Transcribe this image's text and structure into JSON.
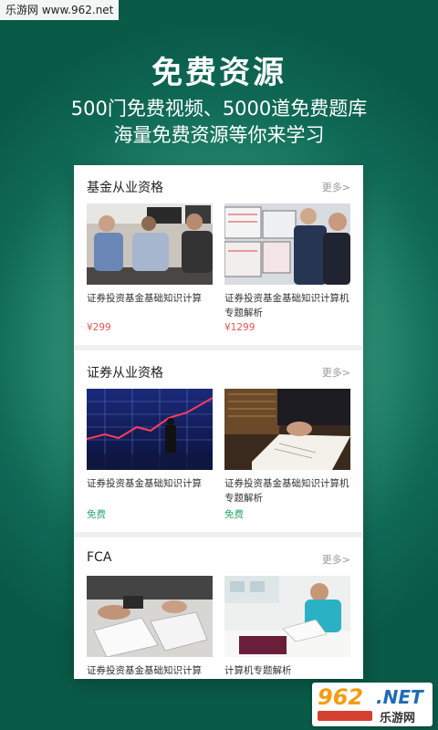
{
  "watermark_top": "乐游网 www.962.net",
  "hero": {
    "title": "免费资源",
    "subtitle_line1": "500门免费视频、5000道免费题库",
    "subtitle_line2": "海量免费资源等你来学习"
  },
  "sections": [
    {
      "title": "基金从业资格",
      "more": "更多>",
      "cards": [
        {
          "title": "证券投资基金基础知识计算",
          "price": "¥299",
          "image": "meeting-photo"
        },
        {
          "title": "证券投资基金基础知识计算机专题解析",
          "price": "¥1299",
          "image": "traders-screens-photo"
        }
      ]
    },
    {
      "title": "证券从业资格",
      "more": "更多>",
      "cards": [
        {
          "title": "证券投资基金基础知识计算",
          "price": "免费",
          "image": "stock-chart-man-photo"
        },
        {
          "title": "证券投资基金基础知识计算机专题解析",
          "price": "免费",
          "image": "signing-document-photo"
        }
      ]
    },
    {
      "title": "FCA",
      "more": "更多>",
      "cards": [
        {
          "title": "证券投资基金基础知识计算",
          "price": "",
          "image": "documents-desk-photo"
        },
        {
          "title": "计算机专题解析",
          "price": "",
          "image": "office-reading-photo"
        }
      ]
    }
  ],
  "watermark_bottom": {
    "num": "962",
    "net": ".NET",
    "cn": "乐游网"
  },
  "colors": {
    "bg_center": "#5fb89a",
    "bg_edge": "#0a5a48",
    "price_paid": "#e05a4e",
    "price_free": "#2aa56b"
  }
}
